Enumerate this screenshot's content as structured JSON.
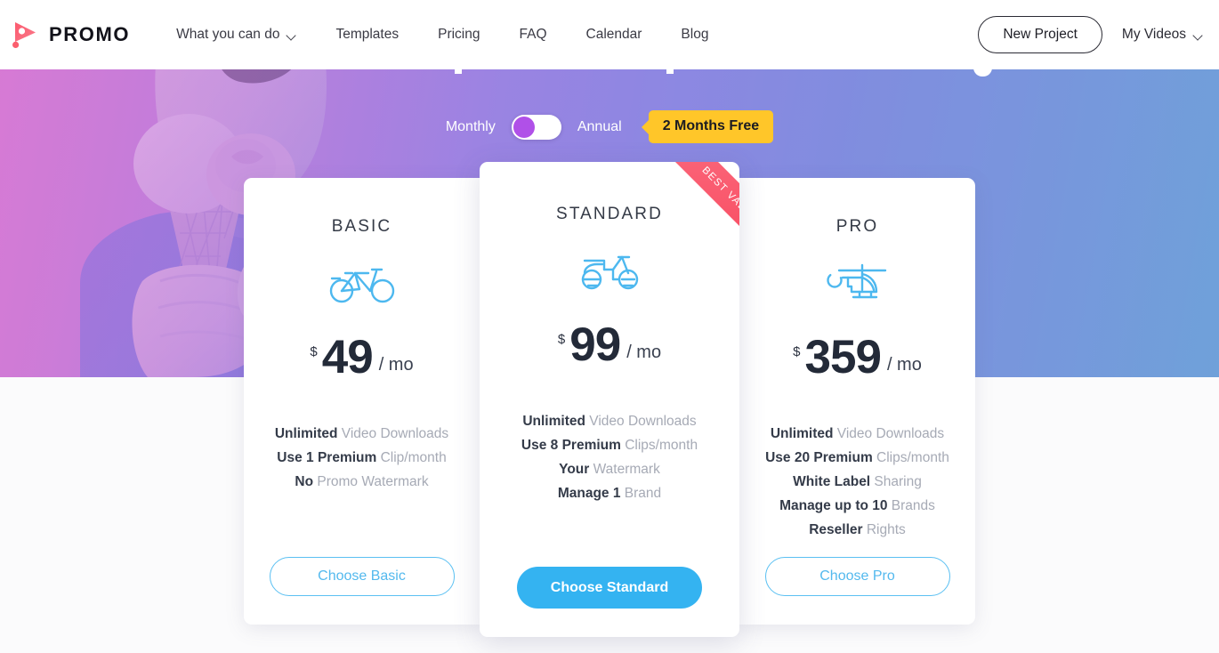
{
  "brand": {
    "name": "PROMO",
    "logo_icon": "play-triangle-icon",
    "logo_color": "#fb5f6e"
  },
  "nav": {
    "links": [
      {
        "label": "What you can do",
        "has_dropdown": true
      },
      {
        "label": "Templates",
        "has_dropdown": false
      },
      {
        "label": "Pricing",
        "has_dropdown": false
      },
      {
        "label": "FAQ",
        "has_dropdown": false
      },
      {
        "label": "Calendar",
        "has_dropdown": false
      },
      {
        "label": "Blog",
        "has_dropdown": false
      }
    ],
    "new_project_label": "New Project",
    "my_videos_label": "My Videos"
  },
  "billing": {
    "monthly_label": "Monthly",
    "annual_label": "Annual",
    "selected": "Monthly",
    "promo_badge": "2 Months Free",
    "badge_color": "#ffc629",
    "knob_color": "#b050e8"
  },
  "hero": {
    "background_type": "photo-gradient",
    "gradient_from": "#d87ad4",
    "gradient_mid": "#8e88e3",
    "gradient_to": "#68aed5",
    "photo_subject": "person-eating-ice-cream"
  },
  "plans": [
    {
      "id": "basic",
      "name": "BASIC",
      "icon": "bicycle-icon",
      "currency": "$",
      "amount": "49",
      "period": "/ mo",
      "featured": false,
      "features": [
        {
          "strong": "Unlimited",
          "rest": " Video Downloads"
        },
        {
          "strong": "Use 1 Premium",
          "rest": " Clip/month"
        },
        {
          "strong": "No",
          "rest": " Promo Watermark"
        }
      ],
      "cta_label": "Choose Basic",
      "cta_style": "outline"
    },
    {
      "id": "standard",
      "name": "STANDARD",
      "icon": "scooter-icon",
      "currency": "$",
      "amount": "99",
      "period": "/ mo",
      "featured": true,
      "ribbon": "BEST VALUE",
      "features": [
        {
          "strong": "Unlimited",
          "rest": " Video Downloads"
        },
        {
          "strong": "Use 8 Premium",
          "rest": " Clips/month"
        },
        {
          "strong": "Your",
          "rest": " Watermark"
        },
        {
          "strong": "Manage 1",
          "rest": " Brand"
        }
      ],
      "cta_label": "Choose Standard",
      "cta_style": "filled"
    },
    {
      "id": "pro",
      "name": "PRO",
      "icon": "helicopter-icon",
      "currency": "$",
      "amount": "359",
      "period": "/ mo",
      "featured": false,
      "features": [
        {
          "strong": "Unlimited",
          "rest": " Video Downloads"
        },
        {
          "strong": "Use 20 Premium",
          "rest": " Clips/month"
        },
        {
          "strong": "White Label",
          "rest": " Sharing"
        },
        {
          "strong": "Manage up to 10",
          "rest": " Brands"
        },
        {
          "strong": "Reseller",
          "rest": " Rights"
        }
      ],
      "cta_label": "Choose Pro",
      "cta_style": "outline"
    }
  ],
  "colors": {
    "accent_blue": "#34b3f1",
    "icon_blue": "#4db8ef",
    "ribbon_red": "#f8495f"
  }
}
